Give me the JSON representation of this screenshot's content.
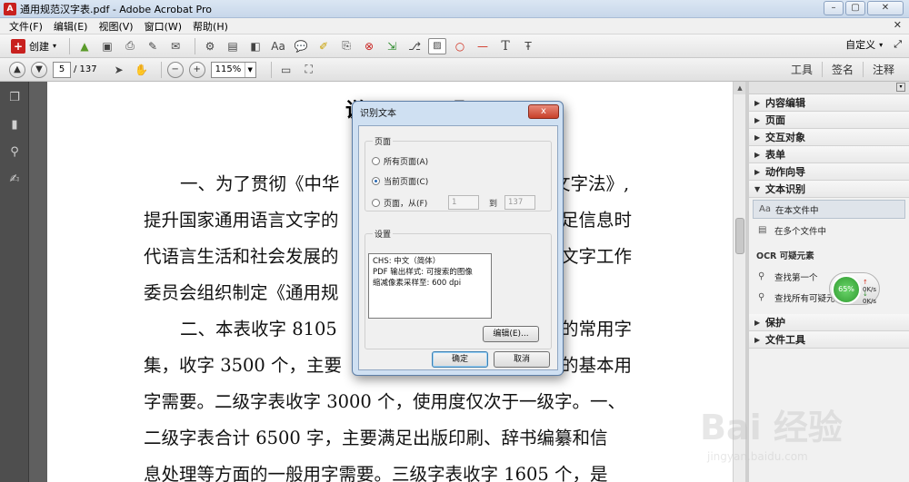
{
  "window": {
    "title": "通用规范汉字表.pdf - Adobe Acrobat Pro"
  },
  "menu": [
    "文件(F)",
    "编辑(E)",
    "视图(V)",
    "窗口(W)",
    "帮助(H)"
  ],
  "toolbar": {
    "create_label": "创建",
    "customize_label": "自定义"
  },
  "nav": {
    "page_number": "5",
    "page_total": "/ 137",
    "zoom": "115%"
  },
  "panel_tabs": [
    "工具",
    "签名",
    "注释"
  ],
  "document": {
    "heading": "说 明",
    "lines": [
      "一、为了贯彻《中华",
      "提升国家通用语言文字的",
      "代语言生活和社会发展的",
      "委员会组织制定《通用规",
      "二、本表收字 8105",
      "集，收字 3500 个，主要",
      "字需要。二级字表收字 3000 个，使用度仅次于一级字。一、",
      "二级字表合计 6500 字，主要满足出版印刷、辞书编纂和信",
      "息处理等方面的一般用字需要。三级字表收字 1605 个，是"
    ],
    "right_fragments": [
      "文字法》,",
      "足信息时",
      "文字工作",
      "的常用字",
      "的基本用"
    ]
  },
  "right_panel": {
    "sections_top": [
      "内容编辑",
      "页面",
      "交互对象",
      "表单",
      "动作向导",
      "文本识别"
    ],
    "text_recognition_items": [
      "在本文件中",
      "在多个文件中"
    ],
    "ocr_title": "OCR 可疑元素",
    "ocr_items": [
      "查找第一个",
      "查找所有可疑元素"
    ],
    "sections_bottom": [
      "保护",
      "文件工具"
    ]
  },
  "net_widget": {
    "percent": "65%",
    "up": "0K/s",
    "down": "0K/s"
  },
  "dialog": {
    "title": "识别文本",
    "close": "x",
    "pages_group": "页面",
    "all_pages": "所有页面(A)",
    "current_page": "当前页面(C)",
    "page_from": "页面，从(F)",
    "from_value": "1",
    "to_label": "到",
    "to_value": "137",
    "settings_group": "设置",
    "settings_lines": [
      "CHS: 中文（简体）",
      "PDF 输出样式: 可搜索的图像",
      "缩减像素采样至: 600 dpi"
    ],
    "edit_button": "编辑(E)...",
    "ok_button": "确定",
    "cancel_button": "取消"
  },
  "watermark": {
    "big": "Bai 经验",
    "small": "jingyan.baidu.com"
  }
}
